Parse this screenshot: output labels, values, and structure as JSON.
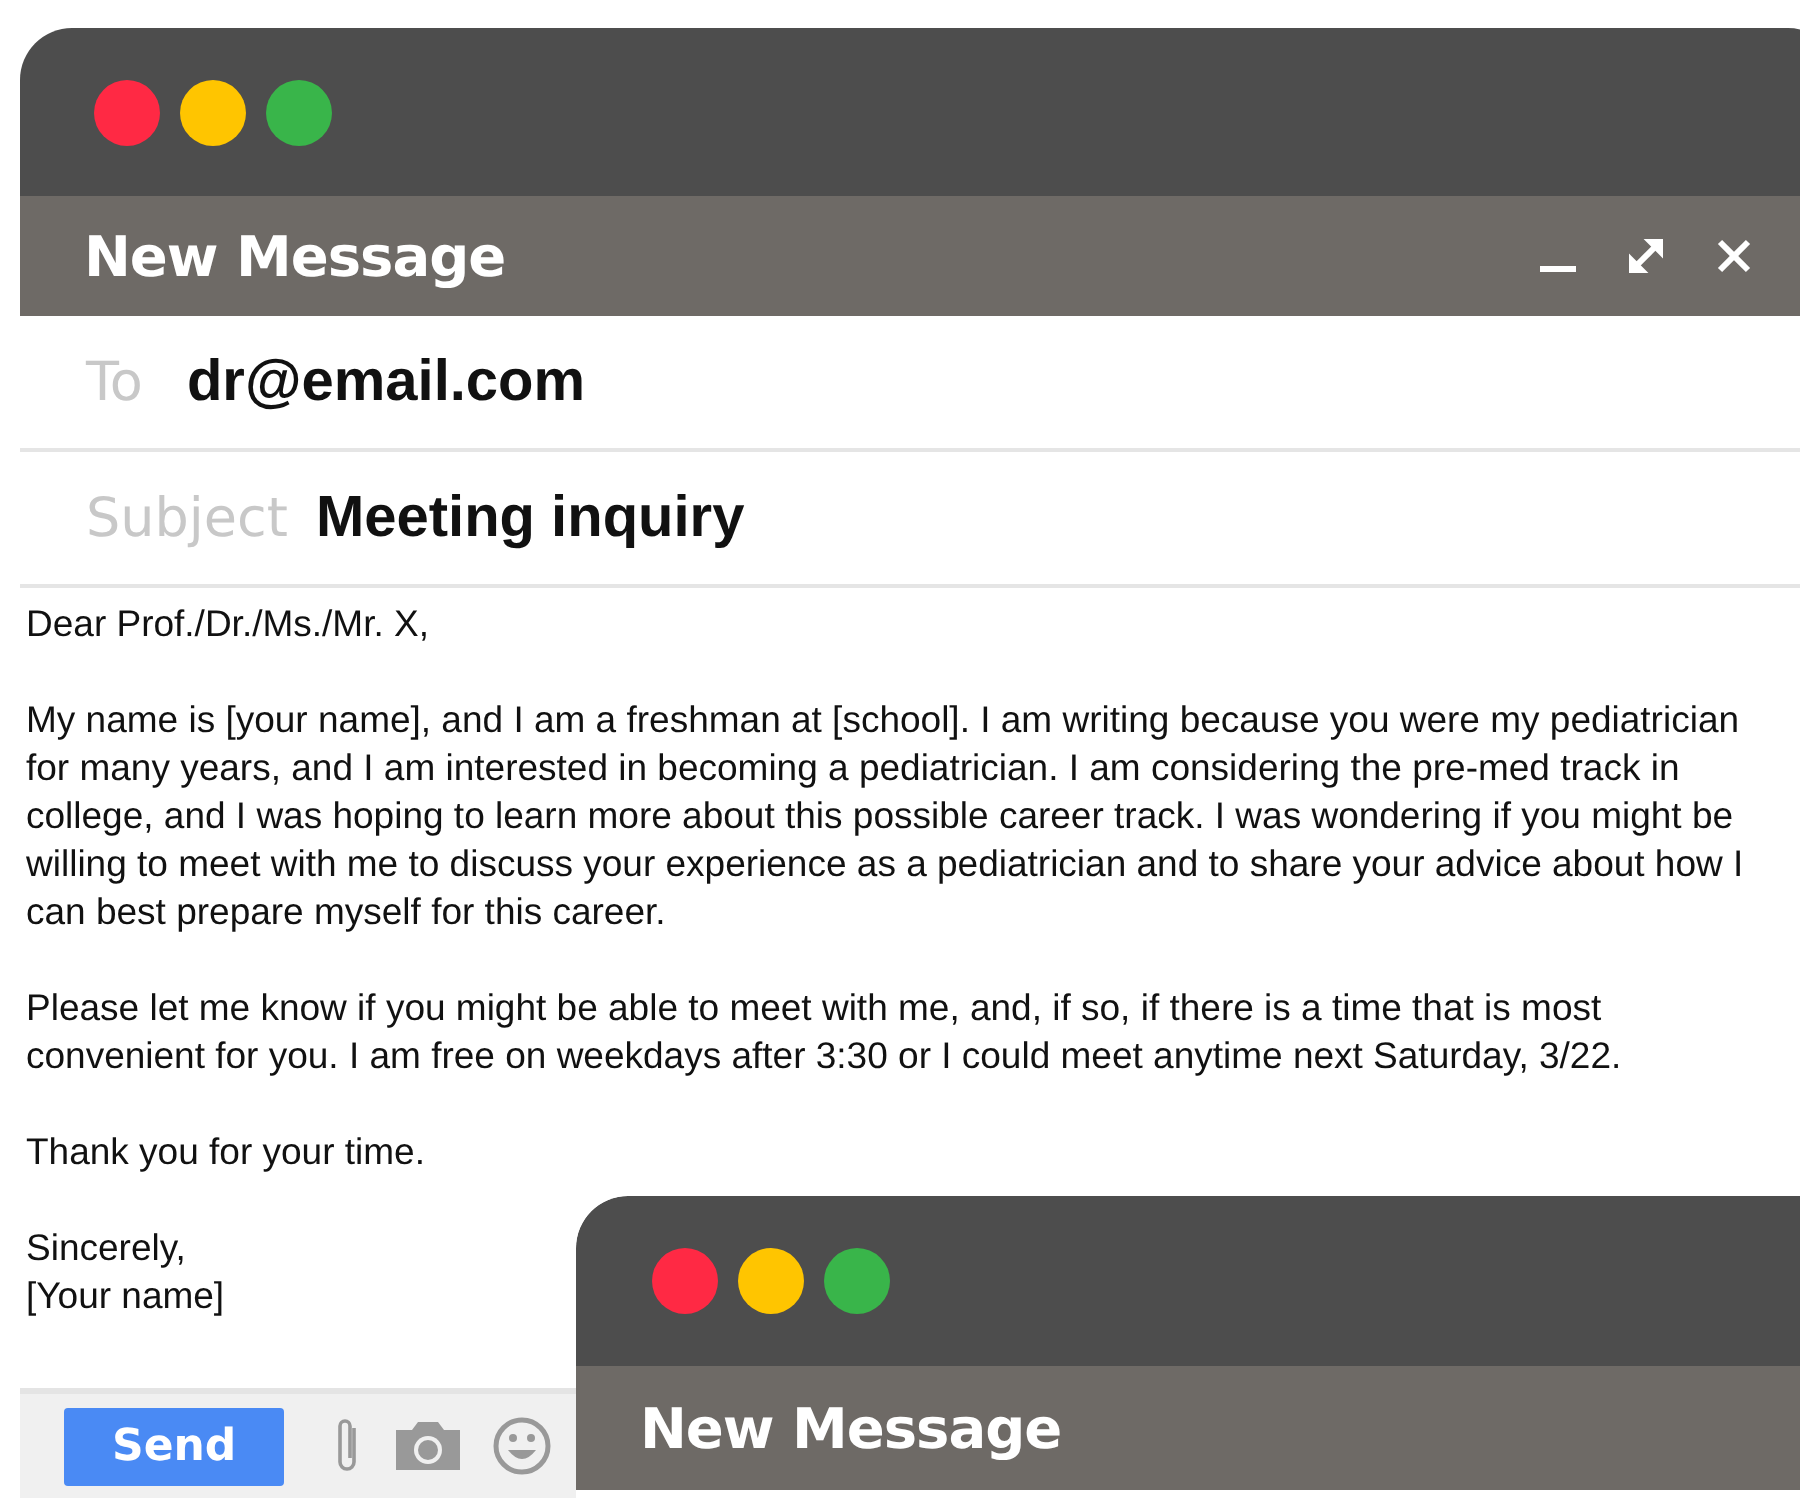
{
  "window": {
    "title": "New Message"
  },
  "to": {
    "label": "To",
    "value": "dr@email.com"
  },
  "subject": {
    "label": "Subject",
    "value": "Meeting inquiry"
  },
  "body": [
    "Dear Prof./Dr./Ms./Mr. X,",
    "My name is [your name], and I am a freshman at [school]. I am writing because you were my pediatrician for many years, and I am interested in becoming a pediatrician. I am considering the pre-med track in college, and I was hoping to learn more about this possible career track. I was wondering if you might be willing to meet with me to discuss your experience as a pediatrician and to share your advice about how I can best prepare myself for this career.",
    "Please let me know if you might be able to meet with me, and, if so, if there is a time that is most convenient for you. I am free on weekdays after 3:30 or I could meet anytime next Saturday, 3/22.",
    "Thank you for your time.",
    "Sincerely,\n[Your name]"
  ],
  "toolbar": {
    "send": "Send"
  },
  "second_window": {
    "title": "New Message"
  }
}
